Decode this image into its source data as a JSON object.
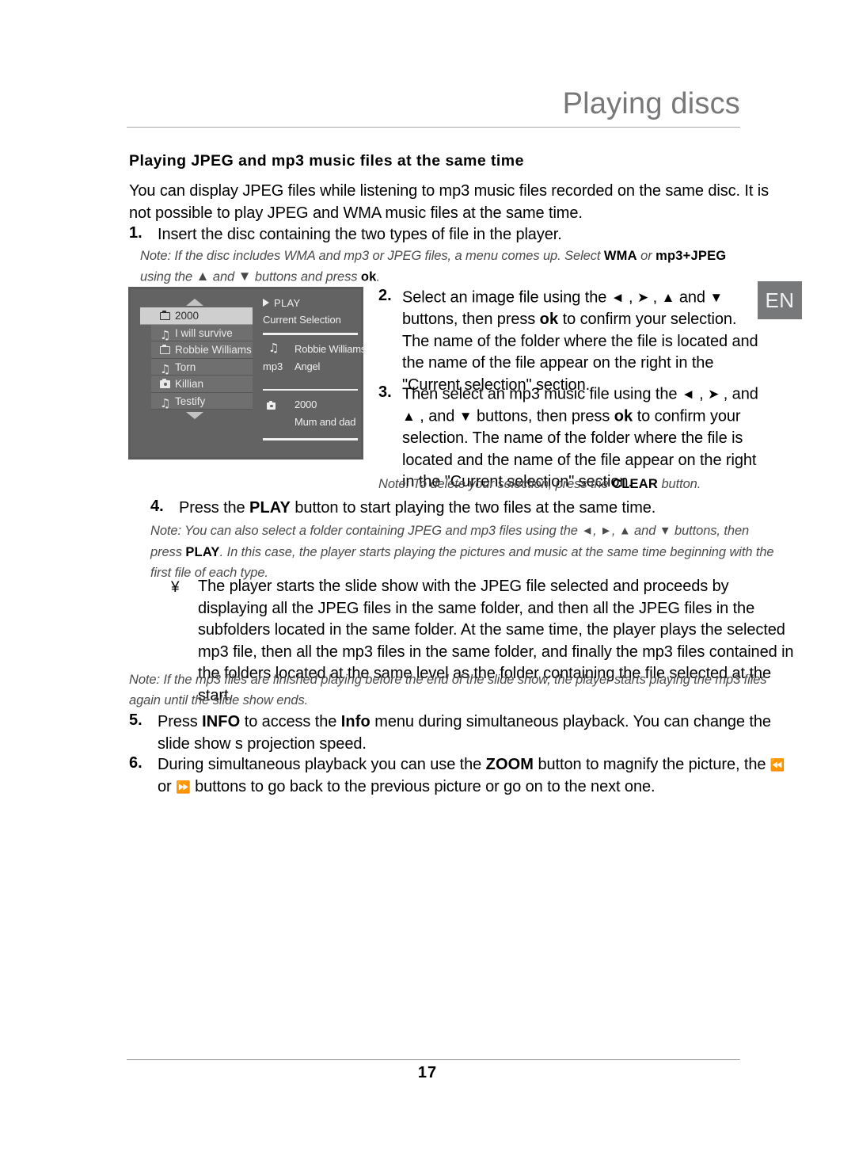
{
  "header": {
    "title": "Playing discs",
    "lang_badge": "EN"
  },
  "section": {
    "heading": "Playing JPEG and mp3 music files at the same time",
    "intro": "You can display JPEG files while listening to mp3 music files recorded on the same disc. It is not possible to play JPEG and WMA music files at the same time."
  },
  "steps": {
    "s1_num": "1.",
    "s1_text": "Insert the disc containing the two types of file in the player.",
    "s1_note_a": "Note: If the disc includes WMA and mp3 or JPEG files, a menu comes up. Select ",
    "s1_note_wma": "WMA",
    "s1_note_or": " or ",
    "s1_note_mp3jpeg": "mp3+JPEG",
    "s1_note_b": "using the ",
    "s1_note_c": " and ",
    "s1_note_d": " buttons and press ",
    "s1_note_ok": "ok",
    "s1_note_e": ".",
    "s2_num": "2.",
    "s2_a": "Select an image file using the ",
    "s2_b": " , ",
    "s2_c": " , ",
    "s2_d": " and ",
    "s2_e": " buttons, then press ",
    "s2_ok": "ok",
    "s2_f": " to confirm your selection. The name of the folder where the file is located and the name of the file appear on the right in the \"Current selection\" section.",
    "s3_num": "3.",
    "s3_a": "Then select an mp3 music file using the ",
    "s3_b": " , ",
    "s3_c": " , and ",
    "s3_d": " buttons, then press ",
    "s3_ok": "ok",
    "s3_e": " to confirm your selection. The name of the folder where the file is located and the name of the file appear on the right in the \"Current selection\" section.",
    "s3_note_a": "Note: To delete your selection, press the ",
    "s3_note_clear": "CLEAR",
    "s3_note_b": " button.",
    "s4_num": "4.",
    "s4_a": "Press the ",
    "s4_play": "PLAY",
    "s4_b": " button to start playing the two files at the same time.",
    "s4_note_a": "Note: You can also select a folder containing JPEG and mp3 files using the ",
    "s4_note_b": ", ",
    "s4_note_c": ", ",
    "s4_note_d": " and ",
    "s4_note_e": " buttons, then press ",
    "s4_note_play": "PLAY",
    "s4_note_f": ". In this case, the player starts playing the pictures and music at the same time beginning with the first file of each type.",
    "bullet_marker": "¥",
    "bullet_text": "The player starts the slide show with the JPEG file selected and proceeds by displaying all the JPEG files in the same folder, and then all the JPEG files in the subfolders located in the same folder. At the same time, the player plays the selected mp3 file, then all the mp3 files in the same folder, and finally the mp3 files contained in the folders located at the same level as the folder containing the file selected at the start.",
    "bullet_note": "Note: If the mp3 files are finished playing before the end of the slide show, the player starts playing the mp3 files again until the slide show ends.",
    "s5_num": "5.",
    "s5_a": "Press ",
    "s5_info1": "INFO",
    "s5_b": " to access the ",
    "s5_info2": "Info",
    "s5_c": " menu during simultaneous playback. You can change the slide show s projection speed.",
    "s6_num": "6.",
    "s6_a": "During simultaneous playback you can use the ",
    "s6_zoom": "ZOOM",
    "s6_b": " button to magnify the picture, the ",
    "s6_prev": "⏪",
    "s6_c": " or ",
    "s6_next": "⏩",
    "s6_d": " buttons to go back to the previous picture or go on to the next one."
  },
  "tv_screen": {
    "menu_items": [
      {
        "icon": "folder-icon",
        "label": "2000",
        "selected": true
      },
      {
        "icon": "music-icon",
        "label": "I will survive",
        "selected": false
      },
      {
        "icon": "folder-icon",
        "label": "Robbie Williams",
        "selected": false
      },
      {
        "icon": "music-icon",
        "label": "Torn",
        "selected": false
      },
      {
        "icon": "picture-icon",
        "label": "Killian",
        "selected": false
      },
      {
        "icon": "music-icon",
        "label": "Testify",
        "selected": false
      }
    ],
    "play_label": "PLAY",
    "current_selection_label": "Current Selection",
    "audio_folder": "Robbie Williams",
    "audio_type": "mp3",
    "audio_file": "Angel",
    "image_folder": "2000",
    "image_file": "Mum and dad"
  },
  "footer": {
    "page_number": "17"
  },
  "colors": {
    "title_gray": "#77787a",
    "tv_bg": "#636363",
    "tv_item_bg": "#6f6f6f",
    "tv_item_selected_bg": "#cfcfcf"
  }
}
